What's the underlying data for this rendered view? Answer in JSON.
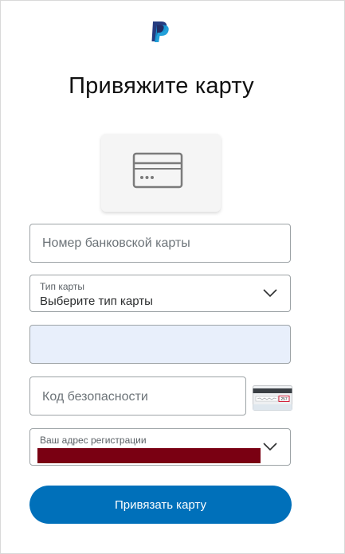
{
  "brand": {
    "logo_icon": "paypal-logo-icon",
    "primary_color": "#0070ba",
    "dark_blue": "#253b80",
    "light_blue": "#179bd7"
  },
  "page": {
    "title": "Привяжите карту"
  },
  "card_illustration": {
    "icon": "credit-card-icon"
  },
  "form": {
    "card_number": {
      "placeholder": "Номер банковской карты"
    },
    "card_type": {
      "label": "Тип карты",
      "value": "Выберите тип карты",
      "icon": "chevron-down-icon"
    },
    "expiry": {
      "value": ""
    },
    "security_code": {
      "placeholder": "Код безопасности",
      "hint_icon": "security-code-card-icon",
      "hint_code": "257"
    },
    "billing_address": {
      "label": "Ваш адрес регистрации",
      "redacted": true,
      "redaction_color": "#7a0012",
      "icon": "chevron-down-icon"
    }
  },
  "actions": {
    "submit_label": "Привязать карту"
  }
}
